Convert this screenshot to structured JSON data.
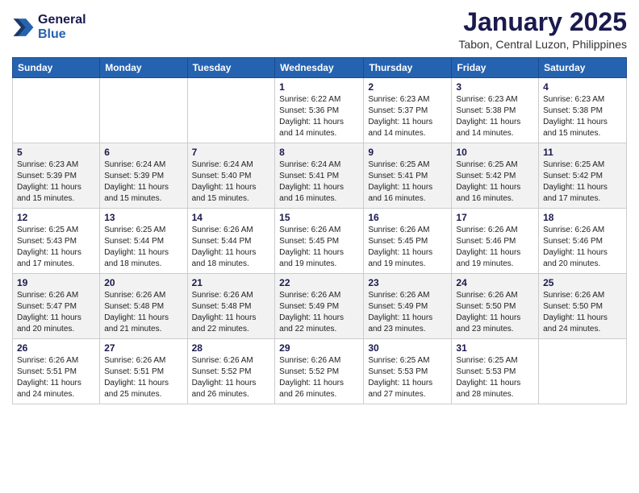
{
  "logo": {
    "line1": "General",
    "line2": "Blue"
  },
  "title": "January 2025",
  "subtitle": "Tabon, Central Luzon, Philippines",
  "days_header": [
    "Sunday",
    "Monday",
    "Tuesday",
    "Wednesday",
    "Thursday",
    "Friday",
    "Saturday"
  ],
  "weeks": [
    [
      {
        "num": "",
        "info": ""
      },
      {
        "num": "",
        "info": ""
      },
      {
        "num": "",
        "info": ""
      },
      {
        "num": "1",
        "info": "Sunrise: 6:22 AM\nSunset: 5:36 PM\nDaylight: 11 hours\nand 14 minutes."
      },
      {
        "num": "2",
        "info": "Sunrise: 6:23 AM\nSunset: 5:37 PM\nDaylight: 11 hours\nand 14 minutes."
      },
      {
        "num": "3",
        "info": "Sunrise: 6:23 AM\nSunset: 5:38 PM\nDaylight: 11 hours\nand 14 minutes."
      },
      {
        "num": "4",
        "info": "Sunrise: 6:23 AM\nSunset: 5:38 PM\nDaylight: 11 hours\nand 15 minutes."
      }
    ],
    [
      {
        "num": "5",
        "info": "Sunrise: 6:23 AM\nSunset: 5:39 PM\nDaylight: 11 hours\nand 15 minutes."
      },
      {
        "num": "6",
        "info": "Sunrise: 6:24 AM\nSunset: 5:39 PM\nDaylight: 11 hours\nand 15 minutes."
      },
      {
        "num": "7",
        "info": "Sunrise: 6:24 AM\nSunset: 5:40 PM\nDaylight: 11 hours\nand 15 minutes."
      },
      {
        "num": "8",
        "info": "Sunrise: 6:24 AM\nSunset: 5:41 PM\nDaylight: 11 hours\nand 16 minutes."
      },
      {
        "num": "9",
        "info": "Sunrise: 6:25 AM\nSunset: 5:41 PM\nDaylight: 11 hours\nand 16 minutes."
      },
      {
        "num": "10",
        "info": "Sunrise: 6:25 AM\nSunset: 5:42 PM\nDaylight: 11 hours\nand 16 minutes."
      },
      {
        "num": "11",
        "info": "Sunrise: 6:25 AM\nSunset: 5:42 PM\nDaylight: 11 hours\nand 17 minutes."
      }
    ],
    [
      {
        "num": "12",
        "info": "Sunrise: 6:25 AM\nSunset: 5:43 PM\nDaylight: 11 hours\nand 17 minutes."
      },
      {
        "num": "13",
        "info": "Sunrise: 6:25 AM\nSunset: 5:44 PM\nDaylight: 11 hours\nand 18 minutes."
      },
      {
        "num": "14",
        "info": "Sunrise: 6:26 AM\nSunset: 5:44 PM\nDaylight: 11 hours\nand 18 minutes."
      },
      {
        "num": "15",
        "info": "Sunrise: 6:26 AM\nSunset: 5:45 PM\nDaylight: 11 hours\nand 19 minutes."
      },
      {
        "num": "16",
        "info": "Sunrise: 6:26 AM\nSunset: 5:45 PM\nDaylight: 11 hours\nand 19 minutes."
      },
      {
        "num": "17",
        "info": "Sunrise: 6:26 AM\nSunset: 5:46 PM\nDaylight: 11 hours\nand 19 minutes."
      },
      {
        "num": "18",
        "info": "Sunrise: 6:26 AM\nSunset: 5:46 PM\nDaylight: 11 hours\nand 20 minutes."
      }
    ],
    [
      {
        "num": "19",
        "info": "Sunrise: 6:26 AM\nSunset: 5:47 PM\nDaylight: 11 hours\nand 20 minutes."
      },
      {
        "num": "20",
        "info": "Sunrise: 6:26 AM\nSunset: 5:48 PM\nDaylight: 11 hours\nand 21 minutes."
      },
      {
        "num": "21",
        "info": "Sunrise: 6:26 AM\nSunset: 5:48 PM\nDaylight: 11 hours\nand 22 minutes."
      },
      {
        "num": "22",
        "info": "Sunrise: 6:26 AM\nSunset: 5:49 PM\nDaylight: 11 hours\nand 22 minutes."
      },
      {
        "num": "23",
        "info": "Sunrise: 6:26 AM\nSunset: 5:49 PM\nDaylight: 11 hours\nand 23 minutes."
      },
      {
        "num": "24",
        "info": "Sunrise: 6:26 AM\nSunset: 5:50 PM\nDaylight: 11 hours\nand 23 minutes."
      },
      {
        "num": "25",
        "info": "Sunrise: 6:26 AM\nSunset: 5:50 PM\nDaylight: 11 hours\nand 24 minutes."
      }
    ],
    [
      {
        "num": "26",
        "info": "Sunrise: 6:26 AM\nSunset: 5:51 PM\nDaylight: 11 hours\nand 24 minutes."
      },
      {
        "num": "27",
        "info": "Sunrise: 6:26 AM\nSunset: 5:51 PM\nDaylight: 11 hours\nand 25 minutes."
      },
      {
        "num": "28",
        "info": "Sunrise: 6:26 AM\nSunset: 5:52 PM\nDaylight: 11 hours\nand 26 minutes."
      },
      {
        "num": "29",
        "info": "Sunrise: 6:26 AM\nSunset: 5:52 PM\nDaylight: 11 hours\nand 26 minutes."
      },
      {
        "num": "30",
        "info": "Sunrise: 6:25 AM\nSunset: 5:53 PM\nDaylight: 11 hours\nand 27 minutes."
      },
      {
        "num": "31",
        "info": "Sunrise: 6:25 AM\nSunset: 5:53 PM\nDaylight: 11 hours\nand 28 minutes."
      },
      {
        "num": "",
        "info": ""
      }
    ]
  ]
}
